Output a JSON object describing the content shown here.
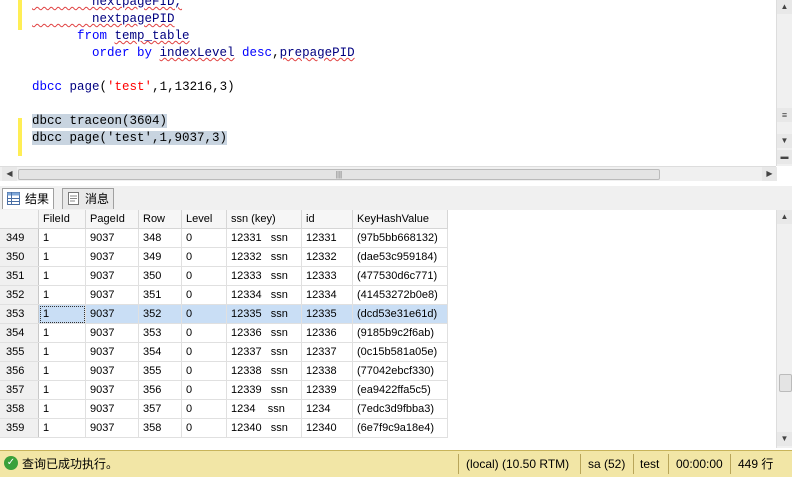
{
  "editor": {
    "lines": [
      {
        "parts": [
          {
            "t": "        nextpageFID,",
            "c": "fn sq"
          }
        ]
      },
      {
        "parts": [
          {
            "t": "        nextpagePID",
            "c": "fn sq"
          }
        ]
      },
      {
        "parts": [
          {
            "t": "      from ",
            "c": "kw"
          },
          {
            "t": "temp_table",
            "c": "fn sq"
          }
        ]
      },
      {
        "parts": [
          {
            "t": "        order by ",
            "c": "kw"
          },
          {
            "t": "indexLevel",
            "c": "fn sq"
          },
          {
            "t": " desc",
            "c": "kw"
          },
          {
            "t": ",",
            "c": ""
          },
          {
            "t": "prepagePID",
            "c": "fn sq"
          }
        ]
      },
      {
        "parts": [
          {
            "t": "",
            "c": ""
          }
        ]
      },
      {
        "parts": [
          {
            "t": "dbcc ",
            "c": "kw"
          },
          {
            "t": "page",
            "c": "fn"
          },
          {
            "t": "(",
            "c": ""
          },
          {
            "t": "'test'",
            "c": "str"
          },
          {
            "t": ",1,13216,3)",
            "c": ""
          }
        ]
      },
      {
        "parts": [
          {
            "t": "",
            "c": ""
          }
        ]
      },
      {
        "parts": [
          {
            "t": "dbcc traceon(3604)",
            "c": "sel"
          }
        ]
      },
      {
        "parts": [
          {
            "t": "dbcc page('test',1,9037,3)",
            "c": "sel"
          }
        ]
      }
    ]
  },
  "scroll_grip": "|||",
  "tabs": [
    {
      "label": "结果",
      "icon": "grid-icon",
      "active": true
    },
    {
      "label": "消息",
      "icon": "message-icon",
      "active": false
    }
  ],
  "grid": {
    "columns": [
      "",
      "FileId",
      "PageId",
      "Row",
      "Level",
      "ssn (key)",
      "id",
      "KeyHashValue"
    ],
    "rows": [
      [
        "349",
        "1",
        "9037",
        "348",
        "0",
        "12331   ssn",
        "12331",
        "(97b5bb668132)"
      ],
      [
        "350",
        "1",
        "9037",
        "349",
        "0",
        "12332   ssn",
        "12332",
        "(dae53c959184)"
      ],
      [
        "351",
        "1",
        "9037",
        "350",
        "0",
        "12333   ssn",
        "12333",
        "(477530d6c771)"
      ],
      [
        "352",
        "1",
        "9037",
        "351",
        "0",
        "12334   ssn",
        "12334",
        "(41453272b0e8)"
      ],
      [
        "353",
        "1",
        "9037",
        "352",
        "0",
        "12335   ssn",
        "12335",
        "(dcd53e31e61d)"
      ],
      [
        "354",
        "1",
        "9037",
        "353",
        "0",
        "12336   ssn",
        "12336",
        "(9185b9c2f6ab)"
      ],
      [
        "355",
        "1",
        "9037",
        "354",
        "0",
        "12337   ssn",
        "12337",
        "(0c15b581a05e)"
      ],
      [
        "356",
        "1",
        "9037",
        "355",
        "0",
        "12338   ssn",
        "12338",
        "(77042ebcf330)"
      ],
      [
        "357",
        "1",
        "9037",
        "356",
        "0",
        "12339   ssn",
        "12339",
        "(ea9422ffa5c5)"
      ],
      [
        "358",
        "1",
        "9037",
        "357",
        "0",
        "1234    ssn",
        "1234",
        "(7edc3d9fbba3)"
      ],
      [
        "359",
        "1",
        "9037",
        "358",
        "0",
        "12340   ssn",
        "12340",
        "(6e7f9c9a18e4)"
      ]
    ],
    "highlighted_row": "353"
  },
  "status": {
    "message": "查询已成功执行。",
    "server": "(local) (10.50 RTM)",
    "user": "sa (52)",
    "database": "test",
    "elapsed": "00:00:00",
    "rows": "449 行"
  },
  "colors": {
    "status_bg": "#f2e6a6",
    "selection": "#c9def5"
  }
}
